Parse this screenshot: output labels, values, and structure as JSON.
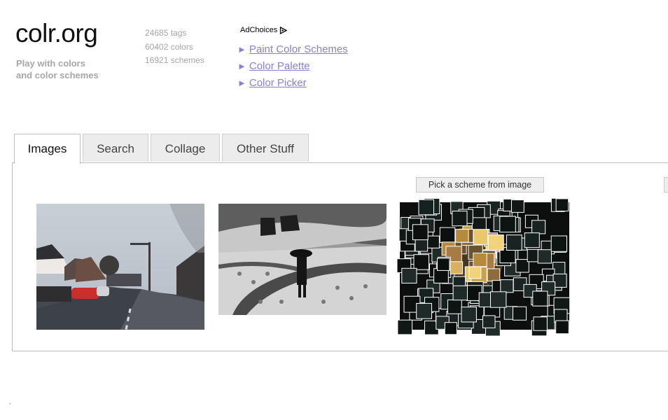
{
  "site": {
    "logo": "colr.org",
    "tagline_line1": "Play with colors",
    "tagline_line2": "and color schemes"
  },
  "stats": {
    "tags": "24685 tags",
    "colors": "60402 colors",
    "schemes": "16921 schemes"
  },
  "ads": {
    "label": "AdChoices"
  },
  "links": [
    {
      "label": "Paint Color Schemes"
    },
    {
      "label": "Color Palette"
    },
    {
      "label": "Color Picker"
    }
  ],
  "link_arrow": "►",
  "tabs": [
    {
      "label": "Images",
      "active": true
    },
    {
      "label": "Search",
      "active": false
    },
    {
      "label": "Collage",
      "active": false
    },
    {
      "label": "Other Stuff",
      "active": false
    }
  ],
  "panel": {
    "pick_button": "Pick a scheme from image"
  },
  "footer": {
    "dot": "-"
  },
  "colors": {
    "link": "#8a7fd8",
    "muted_text": "#a6a6a6",
    "tab_bg": "#ececec",
    "border": "#bfbfbf"
  }
}
